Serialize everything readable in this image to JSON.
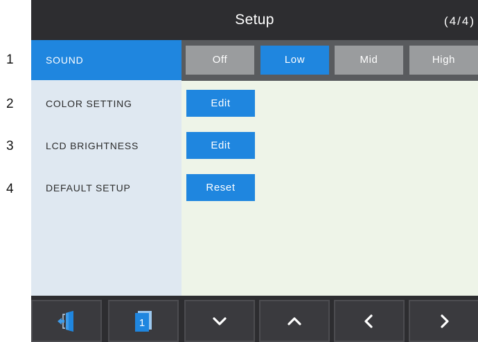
{
  "header": {
    "title": "Setup",
    "page": "(4/4)"
  },
  "row_numbers": [
    "1",
    "2",
    "3",
    "4"
  ],
  "settings": [
    {
      "label": "SOUND"
    },
    {
      "label": "COLOR SETTING",
      "action": "Edit"
    },
    {
      "label": "LCD BRIGHTNESS",
      "action": "Edit"
    },
    {
      "label": "DEFAULT SETUP",
      "action": "Reset"
    }
  ],
  "sound_options": [
    "Off",
    "Low",
    "Mid",
    "High"
  ],
  "sound_selected": "Low",
  "footer": {
    "page_indicator": "1"
  },
  "icons": {
    "exit": "exit-door-icon",
    "page": "page-indicator-icon",
    "down": "chevron-down-icon",
    "up": "chevron-up-icon",
    "prev": "chevron-left-icon",
    "next": "chevron-right-icon"
  },
  "colors": {
    "accent": "#1f86df",
    "header_bg": "#2d2d30",
    "sidebar_bg": "#dfe8f1",
    "content_bg": "#eef4e8",
    "option_bg": "#9a9c9e",
    "option_bar_bg": "#595b5e"
  }
}
